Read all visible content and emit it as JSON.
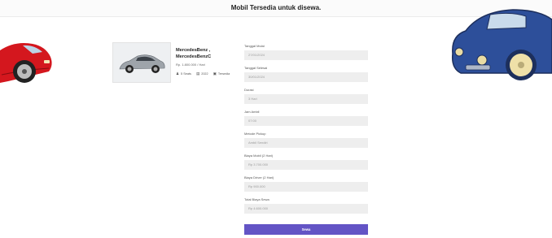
{
  "header": {
    "title": "Mobil Tersedia untuk disewa."
  },
  "car": {
    "name": "MercedesBenz , MercedesBenzC",
    "price": "Rp. 1.800.000 / Hari",
    "seats": "5 Seats",
    "year": "2022",
    "transmission": "Tersedia",
    "icons": [
      "person-icon",
      "calendar-icon",
      "car-icon"
    ]
  },
  "form": {
    "fields": [
      {
        "label": "Tanggal Mulai",
        "value": "27/01/2024"
      },
      {
        "label": "Tanggal Selesai",
        "value": "30/01/2024"
      },
      {
        "label": "Durasi",
        "value": "3 Hari"
      },
      {
        "label": "Jam Ambil",
        "value": "07:00"
      },
      {
        "label": "Metode Pickup",
        "value": "Ambil Sendiri"
      },
      {
        "label": "Biaya Mobil (2 Hari)",
        "value": "Rp 3.700.000"
      },
      {
        "label": "Biaya Driver (2 Hari)",
        "value": "Rp 900.000"
      },
      {
        "label": "Total Biaya Sewa",
        "value": "Rp 4.600.000"
      }
    ],
    "submit_label": "Sewa"
  },
  "colors": {
    "accent": "#6354c5",
    "input_bg": "#eeeeee",
    "left_car": "#d4171e",
    "right_car": "#2d4f9a"
  }
}
